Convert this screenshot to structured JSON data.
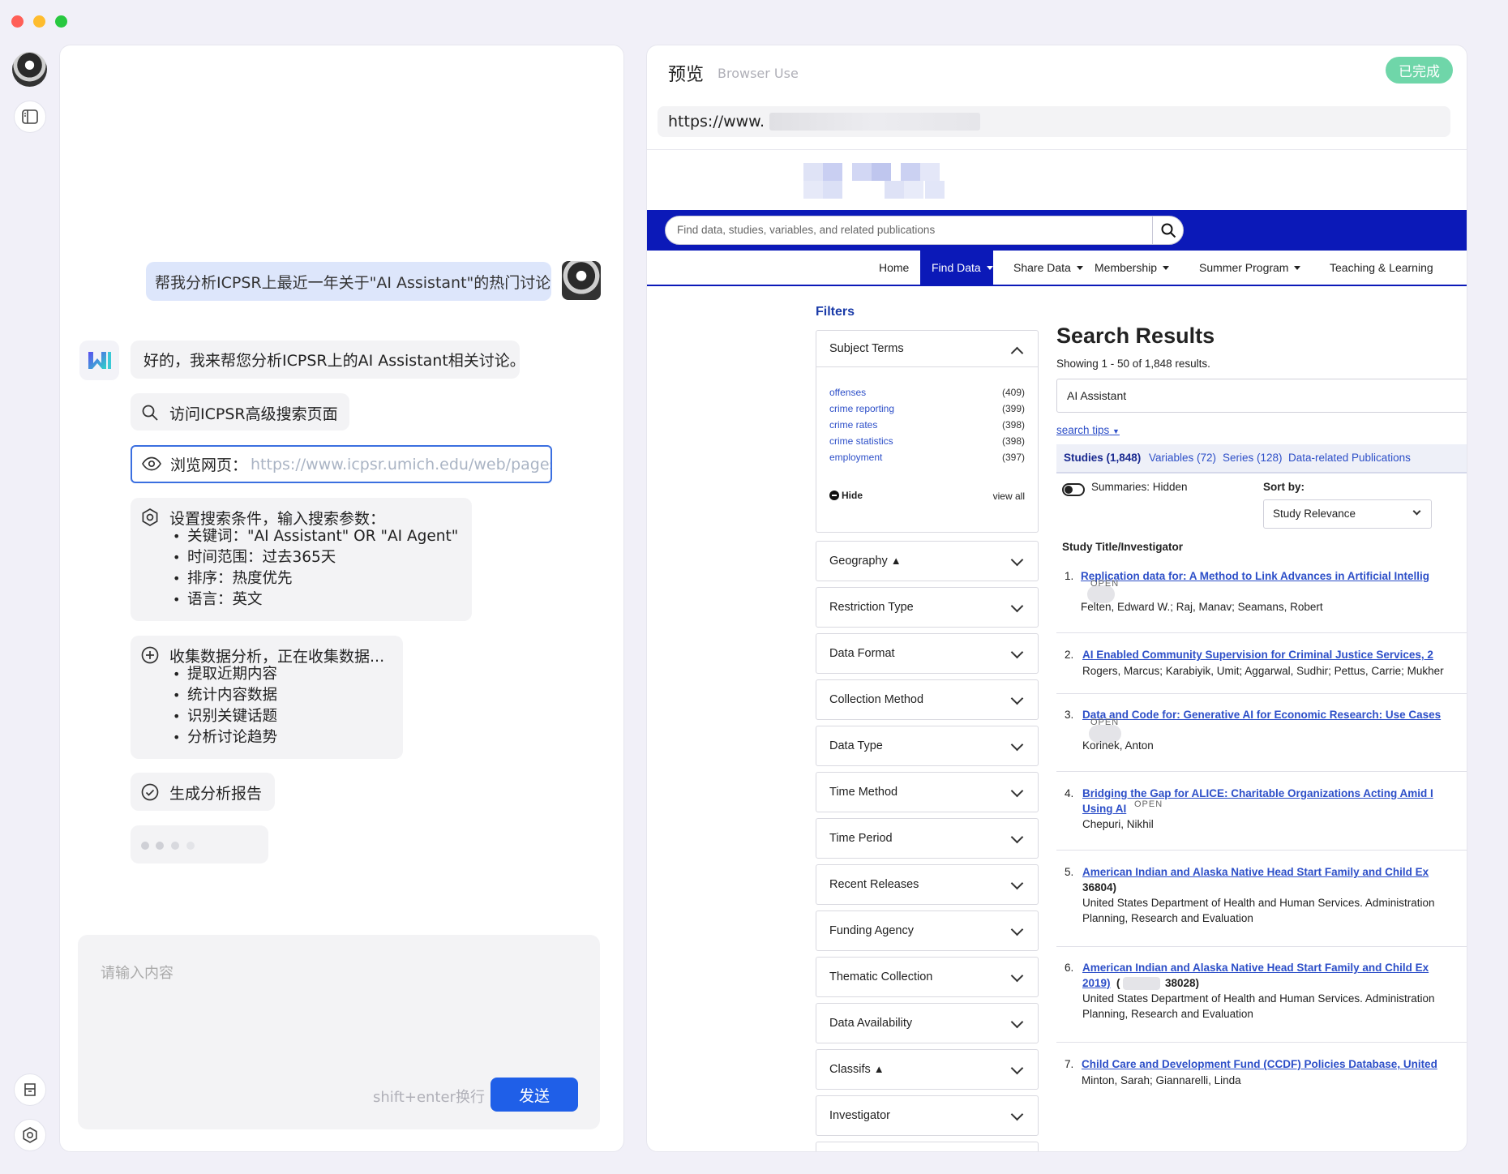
{
  "window": {
    "controls": {
      "close": "#ff5f57",
      "minimize": "#febc2e",
      "maximize": "#28c840"
    }
  },
  "rail": {
    "icons": [
      "avatar",
      "sidebar-toggle-icon",
      "archive-icon",
      "settings-icon"
    ]
  },
  "chat": {
    "user_message": "帮我分析ICPSR上最近一年关于\"AI Assistant\"的热门讨论",
    "bot_reply": "好的，我来帮您分析ICPSR上的AI Assistant相关讨论。",
    "steps": {
      "visit": "访问ICPSR高级搜索页面",
      "browse_label": "浏览网页：",
      "browse_url": "https://www.icpsr.umich.edu/web/pages/",
      "settings_title": "设置搜索条件，输入搜索参数：",
      "settings_items": [
        "关键词：\"AI Assistant\" OR \"AI Agent\"",
        "时间范围：过去365天",
        "排序：热度优先",
        "语言：英文"
      ],
      "collect_title": "收集数据分析，正在收集数据...",
      "collect_items": [
        "提取近期内容",
        "统计内容数据",
        "识别关键话题",
        "分析讨论趋势"
      ],
      "report": "生成分析报告"
    },
    "input": {
      "placeholder": "请输入内容",
      "hint": "shift+enter换行",
      "send_label": "发送"
    }
  },
  "preview": {
    "title": "预览",
    "subtitle": "Browser Use",
    "status": "已完成",
    "url": "https://www.",
    "accent": "#0b19b8",
    "site": {
      "search_placeholder": "Find data, studies, variables, and related publications",
      "menu": [
        "Home",
        "Find Data",
        "Share Data",
        "Membership",
        "Summer Program",
        "Teaching & Learning"
      ],
      "filters_heading": "Filters",
      "subject_terms": {
        "title": "Subject Terms",
        "terms": [
          {
            "label": "offenses",
            "count": "(409)"
          },
          {
            "label": "crime reporting",
            "count": "(399)"
          },
          {
            "label": "crime rates",
            "count": "(398)"
          },
          {
            "label": "crime statistics",
            "count": "(398)"
          },
          {
            "label": "employment",
            "count": "(397)"
          }
        ],
        "hide": "Hide",
        "view_all": "view all"
      },
      "filter_groups": [
        "Geography",
        "Restriction Type",
        "Data Format",
        "Collection Method",
        "Data Type",
        "Time Method",
        "Time Period",
        "Recent Releases",
        "Funding Agency",
        "Thematic Collection",
        "Data Availability",
        "Classifs",
        "Investigator"
      ],
      "results": {
        "heading": "Search Results",
        "showing": "Showing 1 - 50 of 1,848 results.",
        "query": "AI Assistant",
        "search_tips": "search tips",
        "tabs": [
          "Studies (1,848)",
          "Variables (72)",
          "Series (128)",
          "Data-related Publications"
        ],
        "summaries": "Summaries: Hidden",
        "sort_label": "Sort by:",
        "sort_value": "Study Relevance",
        "column_heading": "Study Title/Investigator",
        "open_badge": "OPEN",
        "items": [
          {
            "num": "1.",
            "title": "Replication data for: A Method to Link Advances in Artificial Intellig",
            "authors": "Felten, Edward W.; Raj, Manav; Seamans, Robert"
          },
          {
            "num": "2.",
            "title": "AI Enabled Community Supervision for Criminal Justice Services, 2",
            "authors": "Rogers, Marcus; Karabiyik, Umit; Aggarwal, Sudhir; Pettus, Carrie; Mukher"
          },
          {
            "num": "3.",
            "title": "Data and Code for: Generative AI for Economic Research: Use Cases",
            "authors": "Korinek, Anton"
          },
          {
            "num": "4.",
            "title": "Bridging the Gap for ALICE: Charitable Organizations Acting Amid I",
            "title2": "Using AI",
            "authors": "Chepuri, Nikhil"
          },
          {
            "num": "5.",
            "title": "American Indian and Alaska Native Head Start Family and Child Ex",
            "title2": "36804)",
            "authors": "United States Department of Health and Human Services. Administration",
            "authors2": "Planning, Research and Evaluation"
          },
          {
            "num": "6.",
            "title": "American Indian and Alaska Native Head Start Family and Child Ex",
            "title2": "2019)",
            "title3": "38028)",
            "authors": "United States Department of Health and Human Services. Administration",
            "authors2": "Planning, Research and Evaluation"
          },
          {
            "num": "7.",
            "title": "Child Care and Development Fund (CCDF) Policies Database, United",
            "authors": "Minton, Sarah; Giannarelli, Linda"
          }
        ]
      }
    }
  }
}
